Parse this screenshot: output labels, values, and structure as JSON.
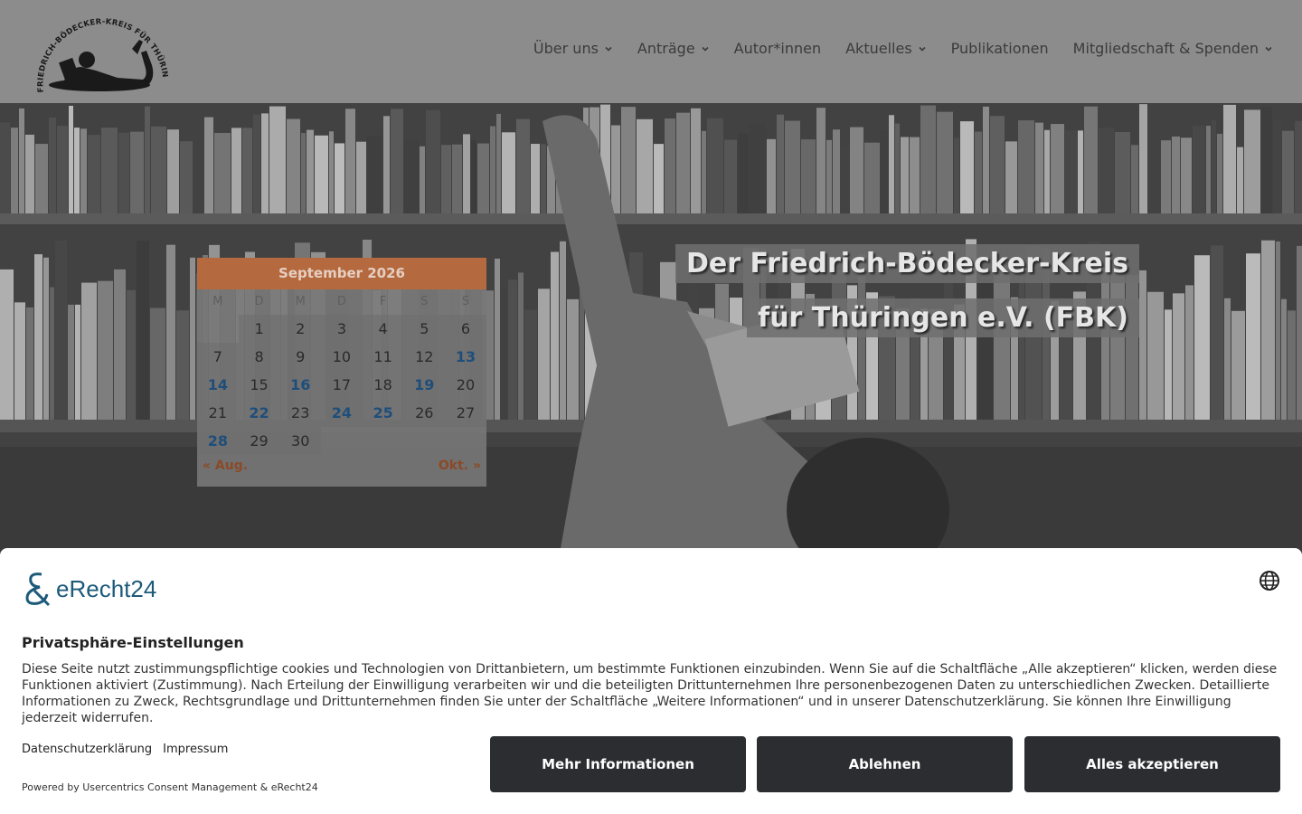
{
  "header": {
    "logo_text": "FRIEDRICH-BÖDECKER-KREIS FÜR THÜRINGEN E.V.",
    "nav": [
      {
        "label": "Über uns",
        "has_dropdown": true
      },
      {
        "label": "Anträge",
        "has_dropdown": true
      },
      {
        "label": "Autor*innen",
        "has_dropdown": false
      },
      {
        "label": "Aktuelles",
        "has_dropdown": true
      },
      {
        "label": "Publikationen",
        "has_dropdown": false
      },
      {
        "label": "Mitgliedschaft & Spenden",
        "has_dropdown": true
      }
    ]
  },
  "hero": {
    "title_line1": "Der Friedrich-Bödecker-Kreis",
    "title_line2": "für Thüringen e.V. (FBK)"
  },
  "calendar": {
    "month": "September 2026",
    "weekdays": [
      "M",
      "D",
      "M",
      "D",
      "F",
      "S",
      "S"
    ],
    "leading_blanks": 1,
    "days": [
      1,
      2,
      3,
      4,
      5,
      6,
      7,
      8,
      9,
      10,
      11,
      12,
      13,
      14,
      15,
      16,
      17,
      18,
      19,
      20,
      21,
      22,
      23,
      24,
      25,
      26,
      27,
      28,
      29,
      30
    ],
    "event_days": [
      13,
      14,
      16,
      19,
      22,
      24,
      25,
      28
    ],
    "prev": "« Aug.",
    "next": "Okt. »"
  },
  "consent": {
    "brand": "eRecht24",
    "title": "Privatsphäre-Einstellungen",
    "body": "Diese Seite nutzt zustimmungspflichtige cookies und Technologien von Drittanbietern, um bestimmte Funktionen einzubinden. Wenn Sie auf die Schaltfläche „Alle akzeptieren“ klicken, werden diese Funktionen aktiviert (Zustimmung). Nach Erteilung der Einwilligung verarbeiten wir und die beteiligten Drittunternehmen Ihre personenbezogenen Daten zu unterschiedlichen Zwecken. Detaillierte Informationen zu Zweck, Rechtsgrundlage und Drittunternehmen finden Sie unter der Schaltfläche „Weitere Informationen“ und in unserer Datenschutzerklärung. Sie können Ihre Einwilligung jederzeit widerrufen.",
    "link_privacy": "Datenschutzerklärung",
    "link_imprint": "Impressum",
    "powered": "Powered by Usercentrics Consent Management & eRecht24",
    "btn_more": "Mehr Informationen",
    "btn_decline": "Ablehnen",
    "btn_accept": "Alles akzeptieren"
  },
  "colors": {
    "header_bg": "#8c8c8c",
    "calendar_accent": "#b5693e",
    "calendar_link": "#1f4e7a",
    "button_dark": "#2b2d31",
    "brand_blue": "#1c5a7a"
  }
}
